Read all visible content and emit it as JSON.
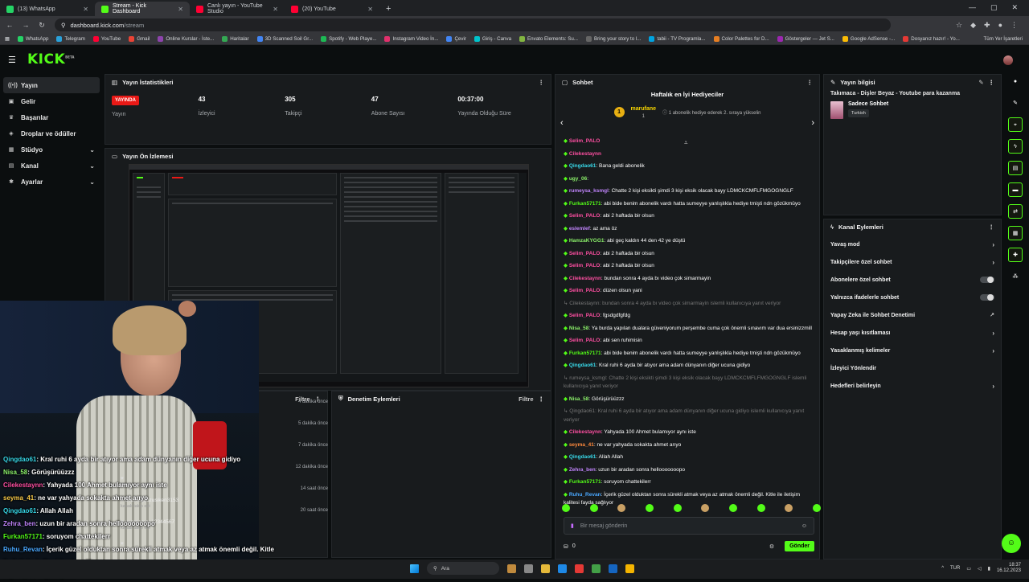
{
  "browser": {
    "tabs": [
      {
        "label": "(13) WhatsApp",
        "color": "#25d366"
      },
      {
        "label": "Stream - Kick Dashboard",
        "color": "#53fc18"
      },
      {
        "label": "Canlı yayın - YouTube Studio",
        "color": "#ff0033"
      },
      {
        "label": "(20) YouTube",
        "color": "#ff0033"
      }
    ],
    "url_host": "dashboard.kick.com",
    "url_path": "/stream",
    "bookmarks": [
      "WhatsApp",
      "Telegram",
      "YouTube",
      "Gmail",
      "Online Kurslar - İste...",
      "Haritalar",
      "3D Scanned Soil Gr...",
      "Spotify - Web Playe...",
      "Instagram Video İn...",
      "Çevir",
      "Giriş - Canva",
      "Envato Elements: Su...",
      "Bring your story to l...",
      "tabii - TV Programla...",
      "Color Palettes for D...",
      "Göstergeler — Jet S...",
      "Google AdSense -...",
      "Dosyanız hazır! - Yo..."
    ],
    "bookmarks_all": "Tüm Yer İşaretleri"
  },
  "sidebar": {
    "items": [
      {
        "label": "Yayın",
        "icon": "radio-icon",
        "glyph": "((•))",
        "active": true
      },
      {
        "label": "Gelir",
        "icon": "wallet-icon",
        "glyph": "▣"
      },
      {
        "label": "Başarılar",
        "icon": "trophy-icon",
        "glyph": "♛"
      },
      {
        "label": "Droplar ve ödüller",
        "icon": "gift-icon",
        "glyph": "◈"
      },
      {
        "label": "Stüdyo",
        "icon": "studio-icon",
        "glyph": "▦",
        "chevron": true
      },
      {
        "label": "Kanal",
        "icon": "channel-icon",
        "glyph": "▤",
        "chevron": true
      },
      {
        "label": "Ayarlar",
        "icon": "gear-icon",
        "glyph": "✱",
        "chevron": true
      }
    ]
  },
  "stats": {
    "title": "Yayın İstatistikleri",
    "live_label": "YAYINDA",
    "items": [
      {
        "value": "",
        "label": "Yayın"
      },
      {
        "value": "43",
        "label": "İzleyici"
      },
      {
        "value": "305",
        "label": "Takipçi"
      },
      {
        "value": "47",
        "label": "Abone Sayısı"
      },
      {
        "value": "00:37:00",
        "label": "Yayında Olduğu Süre"
      }
    ]
  },
  "preview": {
    "title": "Yayın Ön İzlemesi"
  },
  "activity": {
    "filter": "Filtre",
    "times": [
      "4 dakika önce",
      "5 dakika önce",
      "7 dakika önce",
      "12 dakika önce",
      "14 saat önce",
      "20 saat önce"
    ],
    "names": [
      {
        "name": "",
        "sub": "kanalı takip etti"
      },
      {
        "name": "dobloegzozusiken3153",
        "sub": "kanalı takip etti"
      },
      {
        "name": "usernamee12344567",
        "sub": "kanalı takip etti"
      },
      {
        "name": "",
        "sub": "kanalı takip etti"
      }
    ]
  },
  "moderation": {
    "title": "Denetim Eylemleri",
    "filter": "Filtre"
  },
  "overlay_chat": [
    {
      "name": "Qingdao61",
      "color": "#38d8e8",
      "text": ": Kral ruhi 6 ayda bir atıyor ama adam dünyanın diğer ucuna gidiyo"
    },
    {
      "name": "Nisa_58",
      "color": "#8bf06a",
      "text": ": Görüşürüüzzz"
    },
    {
      "name": "Cilekestaynn",
      "color": "#ff4fa2",
      "text": ": Yahyada 100 Ahmet bulamıyor aynı iste"
    },
    {
      "name": "seyma_41",
      "color": "#f7c948",
      "text": ": ne var yahyada sokakta ahmet arıyo"
    },
    {
      "name": "Qingdao61",
      "color": "#38d8e8",
      "text": ": Allah Allah"
    },
    {
      "name": "Zehra_ben",
      "color": "#c084fc",
      "text": ": uzun bir aradan sonra hellooooooopo"
    },
    {
      "name": "Furkan57171",
      "color": "#53fc18",
      "text": ": soruyom chattekilerr"
    },
    {
      "name": "Ruhu_Revan",
      "color": "#4aa8ff",
      "text": ": İçerik güzel olduktan sonra sürekli atmak veya az atmak önemli değil. Kitle"
    },
    {
      "name": "",
      "color": "#ffffff",
      "text": "ile iletişim kalitesi fayda sağlıyor"
    },
    {
      "name": "seyma_41",
      "color": "#f7c948",
      "text": ": özgün içerik"
    }
  ],
  "chat": {
    "title": "Sohbet",
    "hype_title": "Haftalık en İyi Hediyeciler",
    "top_rank": "1",
    "top_user": "marufane",
    "top_count": "1",
    "hype_desc": "1 abonelik hediye ederek 2. sıraya yükselin",
    "messages": [
      {
        "name": "Selim_PALO",
        "cls": "pk",
        "text": ""
      },
      {
        "name": "Cilekestaynn",
        "cls": "pk",
        "text": ""
      },
      {
        "name": "Qingdao61",
        "cls": "cy",
        "text": ": Bana geldi abonelik"
      },
      {
        "name": "ugy_06",
        "cls": "lg",
        "text": ":"
      },
      {
        "name": "rumeysa_ksmgl",
        "cls": "pu",
        "text": ": Chatte 2 kişi eksikti şimdi 3 kişi eksik olacak bayy LDMCKCMFLFMGOGNGLF"
      },
      {
        "name": "Furkan57171",
        "cls": "gn",
        "text": ": abi bide benim abonelik vardı hatta sumeyye yanlışlıkla hediye tmişti ndn gözükmüyo"
      },
      {
        "name": "Selim_PALO",
        "cls": "pk",
        "text": ": abi 2 haftada bir olsun"
      },
      {
        "name": "eslemlef",
        "cls": "pu",
        "text": ": az ama öz"
      },
      {
        "name": "HamzaKYGG1",
        "cls": "lg",
        "text": ": abi geç kaldın 44 den 42 ye düştü"
      },
      {
        "name": "Selim_PALO",
        "cls": "pk",
        "text": ": abi 2 haftada bir olsun"
      },
      {
        "name": "Selim_PALO",
        "cls": "pk",
        "text": ": abi 2 haftada bir olsun"
      },
      {
        "name": "Cilekestaynn",
        "cls": "pk",
        "text": ": bundan sonra 4 ayda bı video çok simarmayin"
      },
      {
        "name": "Selim_PALO",
        "cls": "pk",
        "text": ": düzen olsun yani"
      },
      {
        "name": "",
        "cls": "dim",
        "text": "Cilekestaynn: bundan sonra 4 ayda bı video çok simarmayin islemli kullanıcıya yanıt veriyor"
      },
      {
        "name": "Selim_PALO",
        "cls": "pk",
        "text": ": fgsdgdfgfdg"
      },
      {
        "name": "Nisa_58",
        "cls": "lg",
        "text": ": Ya burda yapılan dualara güveniyorum perşembe cuma çok önemli sınavım var dua ersinizzmill"
      },
      {
        "name": "Selim_PALO",
        "cls": "pk",
        "text": ": abi sen ruhimisin"
      },
      {
        "name": "Furkan57171",
        "cls": "gn",
        "text": ": abi bide benim abonelik vardı hatta sumeyye yanlışlıkla hediye tmişti ndn gözükmüyo"
      },
      {
        "name": "Qingdao61",
        "cls": "cy",
        "text": ": Kral ruhi 6 ayda bir atıyor ama adam dünyanın diğer ucuna gidiyo"
      },
      {
        "name": "",
        "cls": "dim",
        "text": "rumeysa_ksmgl: Chatte 2 kişi eksikti şimdi 3 kişi eksik olacak bayy LDMCKCMFLFMGOGNGLF islemli kullanıcıya yanıt veriyor"
      },
      {
        "name": "Nisa_58",
        "cls": "lg",
        "text": ": Görüşürüüzzz"
      },
      {
        "name": "",
        "cls": "dim",
        "text": "Qingdao61: Kral ruhi 6 ayda bir atıyor ama adam dünyanın diğer ucuna gidiyo islemli kullanıcıya yanıt veriyor"
      },
      {
        "name": "Cilekestaynn",
        "cls": "pk",
        "text": ": Yahyada 100 Ahmet bulamıyor aynı iste"
      },
      {
        "name": "seyma_41",
        "cls": "or",
        "text": ": ne var yahyada sokakta ahmet arıyo"
      },
      {
        "name": "Qingdao61",
        "cls": "cy",
        "text": ": Allah Allah"
      },
      {
        "name": "Zehra_ben",
        "cls": "pu",
        "text": ": uzun bir aradan sonra hellooooooopo"
      },
      {
        "name": "Furkan57171",
        "cls": "gn",
        "text": ": soruyom chattekilerr"
      },
      {
        "name": "Ruhu_Revan",
        "cls": "bl",
        "text": ": İçerik güzel olduktan sonra sürekli atmak veya az atmak önemli değil. Kitle ile iletişim kalitesi fayda sağlıyor"
      }
    ],
    "placeholder": "Bir mesaj gönderin",
    "points": "0",
    "send_label": "Gönder"
  },
  "stream_info": {
    "title": "Yayın bilgisi",
    "stream_title": "Takımaca - Dişler Beyaz - Youtube para kazanma",
    "category": "Sadece Sohbet",
    "tag": "Turkish"
  },
  "channel_actions": {
    "title": "Kanal Eylemleri",
    "items": [
      {
        "label": "Yavaş mod",
        "kind": "chevron"
      },
      {
        "label": "Takipçilere özel sohbet",
        "kind": "chevron"
      },
      {
        "label": "Abonelere özel sohbet",
        "kind": "toggle"
      },
      {
        "label": "Yalnızca ifadelerle sohbet",
        "kind": "toggle"
      },
      {
        "label": "Yapay Zeka ile Sohbet Denetimi",
        "kind": "external"
      },
      {
        "label": "Hesap yaşı kısıtlaması",
        "kind": "chevron"
      },
      {
        "label": "Yasaklanmış kelimeler",
        "kind": "chevron"
      },
      {
        "label": "İzleyici Yönlendir",
        "kind": "none"
      },
      {
        "label": "Hedefleri belirleyin",
        "kind": "chevron"
      }
    ]
  },
  "taskbar": {
    "search": "Ara",
    "lang": "TUR",
    "time": "18:37",
    "date": "16.12.2023"
  },
  "colors": {
    "accent": "#53fc18",
    "live": "#e91916"
  }
}
